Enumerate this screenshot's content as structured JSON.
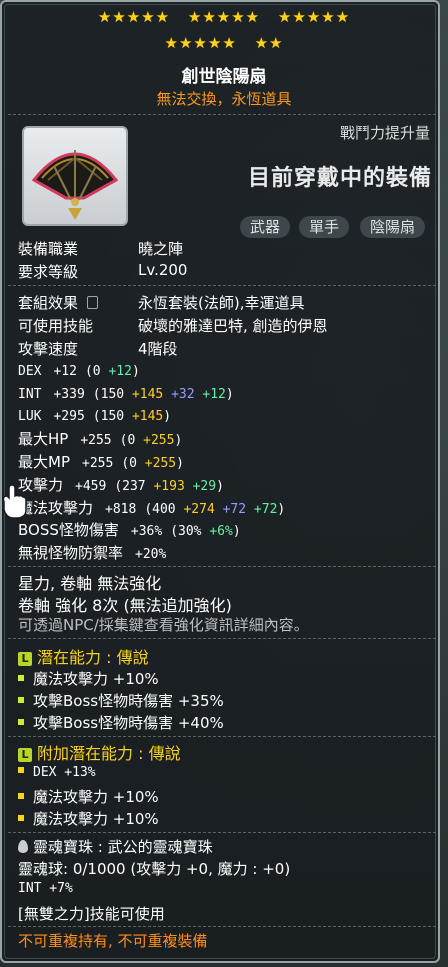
{
  "stars": {
    "row1": [
      "★★★★★",
      "★★★★★",
      "★★★★★"
    ],
    "row2": [
      "★★★★★",
      "★★"
    ]
  },
  "item": {
    "name": "創世陰陽扇",
    "subtitle": "無法交換，永恆道具",
    "icon": "fan-weapon-icon"
  },
  "header": {
    "cp_label": "戰鬥力提升量",
    "equipped_label": "目前穿戴中的裝備",
    "tags": [
      "武器",
      "單手",
      "陰陽扇"
    ]
  },
  "requirements": [
    {
      "label": "裝備職業",
      "value": "曉之陣"
    },
    {
      "label": "要求等級",
      "value": "Lv.200"
    }
  ],
  "info": [
    {
      "label": "套組效果",
      "value": "永恆套裝(法師),幸運道具"
    },
    {
      "label": "可使用技能",
      "value": "破壞的雅達巴特, 創造的伊恩"
    },
    {
      "label": "攻擊速度",
      "value": "4階段"
    }
  ],
  "stats": [
    {
      "label": "DEX",
      "total": "+12",
      "parts": [
        {
          "t": "(0 ",
          "c": ""
        },
        {
          "t": "+12",
          "c": "g"
        },
        {
          "t": ")",
          "c": ""
        }
      ]
    },
    {
      "label": "INT",
      "total": "+339",
      "parts": [
        {
          "t": "(150 ",
          "c": ""
        },
        {
          "t": "+145",
          "c": "y"
        },
        {
          "t": " +32",
          "c": "b"
        },
        {
          "t": " +12",
          "c": "g"
        },
        {
          "t": ")",
          "c": ""
        }
      ]
    },
    {
      "label": "LUK",
      "total": "+295",
      "parts": [
        {
          "t": "(150 ",
          "c": ""
        },
        {
          "t": "+145",
          "c": "y"
        },
        {
          "t": ")",
          "c": ""
        }
      ]
    },
    {
      "label": "最大HP",
      "total": "+255",
      "parts": [
        {
          "t": "(0 ",
          "c": ""
        },
        {
          "t": "+255",
          "c": "y"
        },
        {
          "t": ")",
          "c": ""
        }
      ]
    },
    {
      "label": "最大MP",
      "total": "+255",
      "parts": [
        {
          "t": "(0 ",
          "c": ""
        },
        {
          "t": "+255",
          "c": "y"
        },
        {
          "t": ")",
          "c": ""
        }
      ]
    },
    {
      "label": "攻擊力",
      "total": "+459",
      "parts": [
        {
          "t": "(237 ",
          "c": ""
        },
        {
          "t": "+193",
          "c": "y"
        },
        {
          "t": " +29",
          "c": "g"
        },
        {
          "t": ")",
          "c": ""
        }
      ]
    },
    {
      "label": "魔法攻擊力",
      "total": "+818",
      "parts": [
        {
          "t": "(400 ",
          "c": ""
        },
        {
          "t": "+274",
          "c": "y"
        },
        {
          "t": " +72",
          "c": "b"
        },
        {
          "t": " +72",
          "c": "g"
        },
        {
          "t": ")",
          "c": ""
        }
      ]
    },
    {
      "label": "BOSS怪物傷害",
      "total": "+36%",
      "parts": [
        {
          "t": "(30% ",
          "c": ""
        },
        {
          "t": "+6%",
          "c": "g"
        },
        {
          "t": ")",
          "c": ""
        }
      ]
    },
    {
      "label": "無視怪物防禦率",
      "total": "+20%",
      "parts": []
    }
  ],
  "enhance": {
    "line1": "星力, 卷軸 無法強化",
    "line2": "卷軸 強化 8次 (無法追加強化)",
    "hint": "可透過NPC/採集鍵查看強化資訊詳細內容。"
  },
  "potential": {
    "title": "潛在能力 : 傳說",
    "badge": "L",
    "lines": [
      "魔法攻擊力 +10%",
      "攻擊Boss怪物時傷害 +35%",
      "攻擊Boss怪物時傷害 +40%"
    ]
  },
  "additional": {
    "title": "附加潛在能力 : 傳說",
    "badge": "L",
    "lines": [
      "DEX +13%",
      "魔法攻擊力 +10%",
      "魔法攻擊力 +10%"
    ]
  },
  "soul": {
    "title": "靈魂寶珠 : 武公的靈魂寶珠",
    "orb": "靈魂球: 0/1000 (攻擊力 +0, 魔力 : +0)",
    "stat": "INT +7%",
    "skill": "[無雙之力]技能可使用"
  },
  "footer": "不可重複持有, 不可重複裝備",
  "colors": {
    "star": "#ffd21a",
    "subtitle": "#ff9a1a",
    "bonus_yellow": "#ffcf26",
    "bonus_blue": "#9a9cff",
    "bonus_green": "#66f2a4",
    "footer": "#ff8e1a"
  }
}
